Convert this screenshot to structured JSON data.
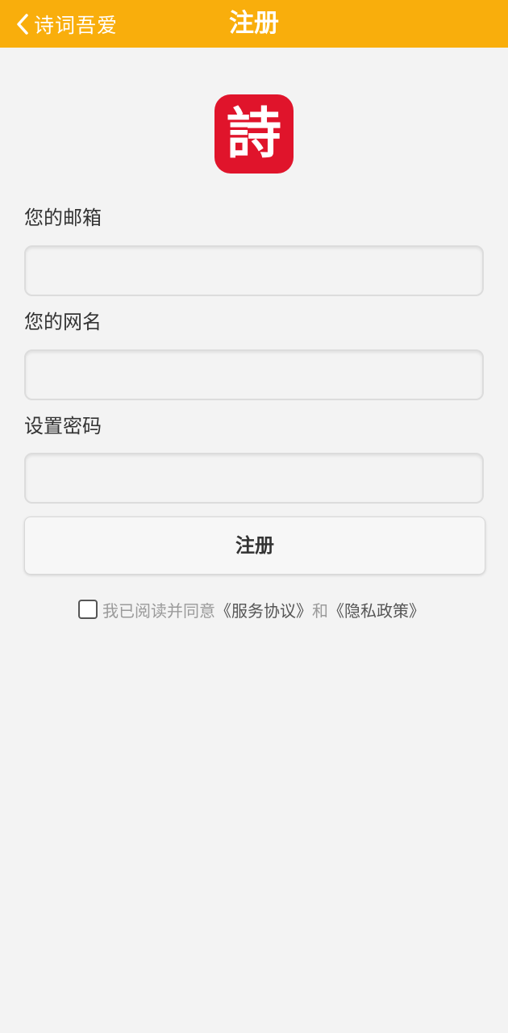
{
  "header": {
    "back_label": "诗词吾爱",
    "title": "注册"
  },
  "logo": {
    "glyph": "詩"
  },
  "form": {
    "email_label": "您的邮箱",
    "email_value": "",
    "nickname_label": "您的网名",
    "nickname_value": "",
    "password_label": "设置密码",
    "password_value": "",
    "submit_label": "注册"
  },
  "agreement": {
    "checked": false,
    "prefix": "我已阅读并同意",
    "service_link": "《服务协议》",
    "joiner": "和",
    "privacy_link": "《隐私政策》"
  },
  "colors": {
    "header_bg": "#f9ae0c",
    "logo_bg": "#e0142b",
    "page_bg": "#f3f3f3"
  }
}
